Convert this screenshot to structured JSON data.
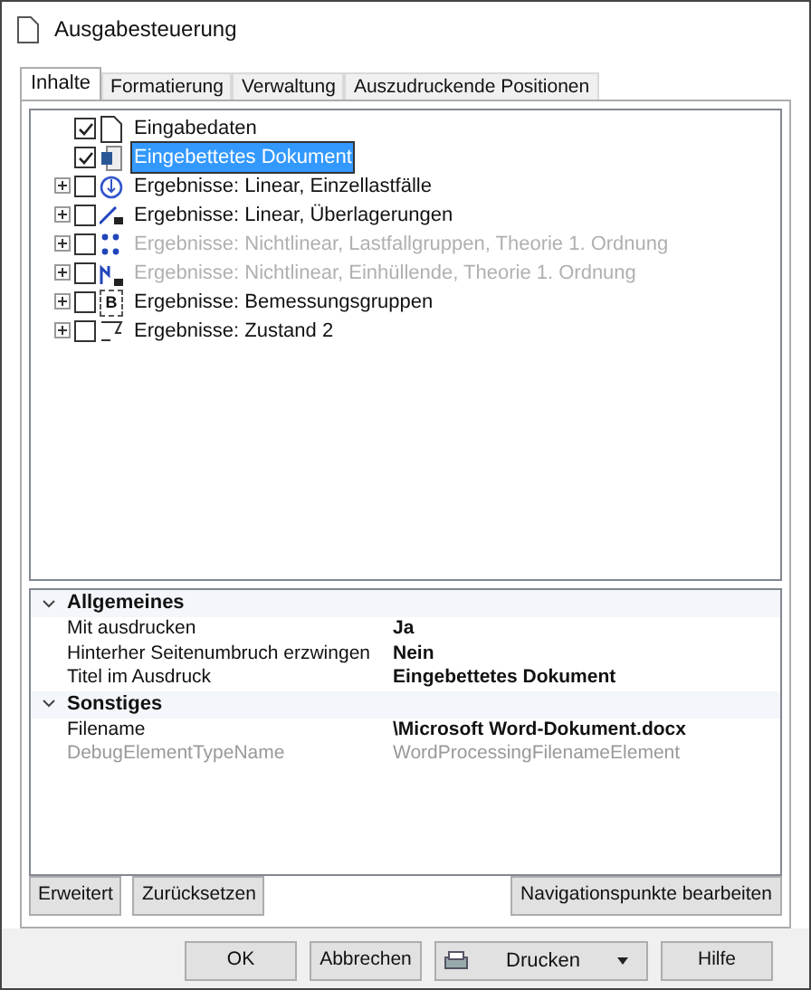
{
  "window": {
    "title": "Ausgabesteuerung"
  },
  "tabs": [
    {
      "label": "Inhalte",
      "selected": true
    },
    {
      "label": "Formatierung",
      "selected": false
    },
    {
      "label": "Verwaltung",
      "selected": false
    },
    {
      "label": "Auszudruckende Positionen",
      "selected": false
    }
  ],
  "tree": {
    "items": [
      {
        "label": "Eingabedaten",
        "kind": "page",
        "checked": true,
        "expandable": false,
        "disabled": false,
        "selected": false
      },
      {
        "label": "Eingebettetes Dokument",
        "kind": "embedded",
        "checked": true,
        "expandable": false,
        "disabled": false,
        "selected": true
      },
      {
        "label": "Ergebnisse: Linear, Einzellastfälle",
        "kind": "load",
        "checked": false,
        "expandable": true,
        "disabled": false,
        "selected": false
      },
      {
        "label": "Ergebnisse: Linear, Überlagerungen",
        "kind": "line",
        "checked": false,
        "expandable": true,
        "disabled": false,
        "selected": false
      },
      {
        "label": "Ergebnisse: Nichtlinear, Lastfallgruppen, Theorie 1. Ordnung",
        "kind": "dots",
        "checked": false,
        "expandable": true,
        "disabled": true,
        "selected": false
      },
      {
        "label": "Ergebnisse: Nichtlinear, Einhüllende, Theorie 1. Ordnung",
        "kind": "step",
        "checked": false,
        "expandable": true,
        "disabled": true,
        "selected": false
      },
      {
        "label": "Ergebnisse: Bemessungsgruppen",
        "kind": "letter",
        "glyph": "B",
        "checked": false,
        "expandable": true,
        "disabled": false,
        "selected": false
      },
      {
        "label": "Ergebnisse: Zustand 2",
        "kind": "state",
        "checked": false,
        "expandable": true,
        "disabled": false,
        "selected": false
      }
    ]
  },
  "properties": [
    {
      "category": "Allgemeines",
      "expanded": true,
      "rows": [
        {
          "name": "Mit ausdrucken",
          "value": "Ja",
          "disabled": false
        },
        {
          "name": "Hinterher Seitenumbruch erzwingen",
          "value": "Nein",
          "disabled": false
        },
        {
          "name": "Titel im Ausdruck",
          "value": "Eingebettetes Dokument",
          "disabled": false
        }
      ]
    },
    {
      "category": "Sonstiges",
      "expanded": true,
      "rows": [
        {
          "name": "Filename",
          "value": "\\Microsoft Word-Dokument.docx",
          "disabled": false
        },
        {
          "name": "DebugElementTypeName",
          "value": "WordProcessingFilenameElement",
          "disabled": true
        }
      ]
    }
  ],
  "panel_buttons": {
    "left": [
      "Erweitert",
      "Zurücksetzen"
    ],
    "right": [
      "Navigationspunkte bearbeiten"
    ]
  },
  "dialog_buttons": [
    {
      "label": "OK",
      "kind": "plain"
    },
    {
      "label": "Abbrechen",
      "kind": "plain"
    },
    {
      "label": "Drucken",
      "kind": "print"
    },
    {
      "label": "Hilfe",
      "kind": "plain"
    }
  ]
}
